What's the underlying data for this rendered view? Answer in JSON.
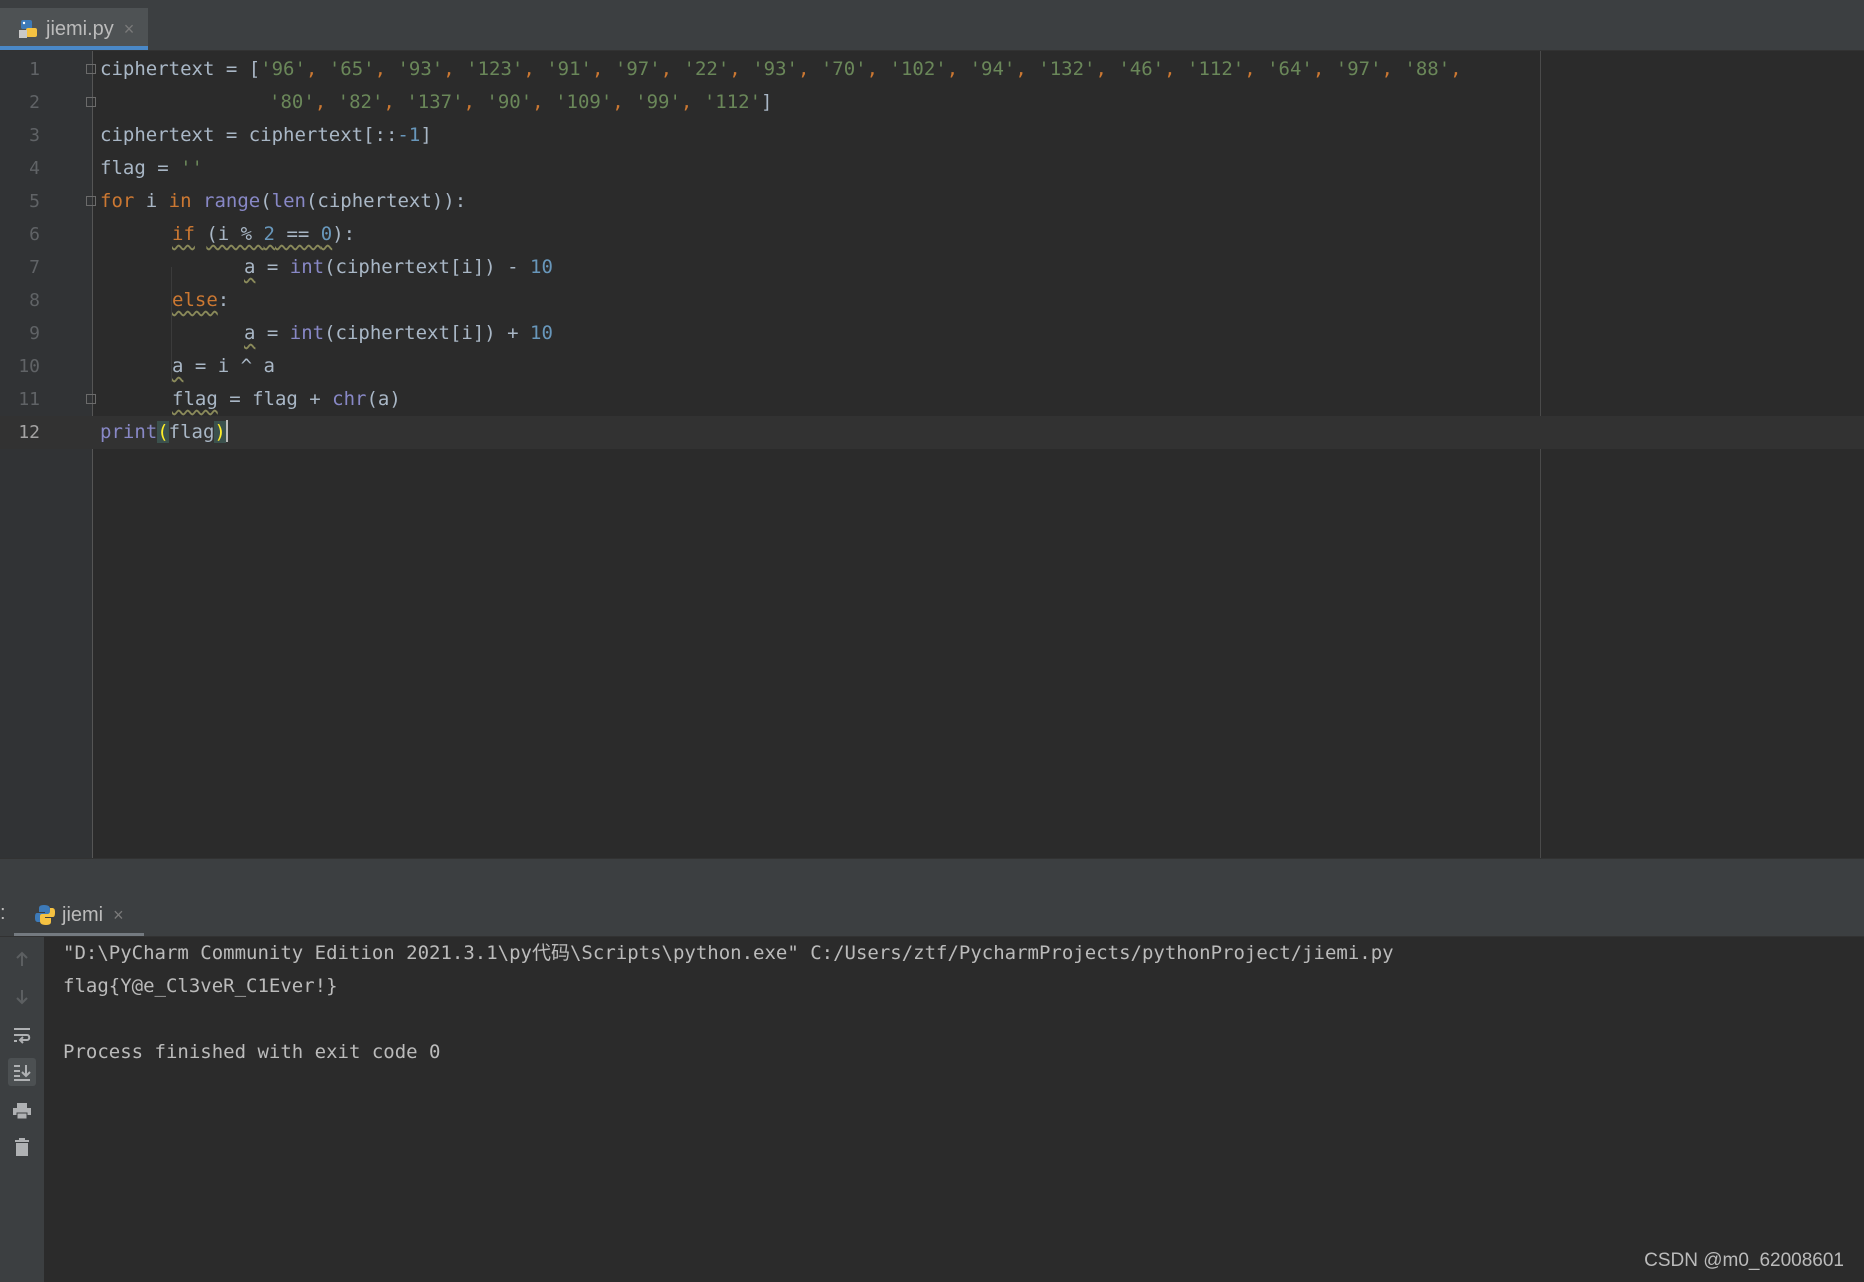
{
  "editor_tab": {
    "label": "jiemi.py",
    "close": "×"
  },
  "line_numbers": [
    "1",
    "2",
    "3",
    "4",
    "5",
    "6",
    "7",
    "8",
    "9",
    "10",
    "11",
    "12"
  ],
  "code": {
    "l1": {
      "p0": "ciphertext = [",
      "items": [
        "'96'",
        "'65'",
        "'93'",
        "'123'",
        "'91'",
        "'97'",
        "'22'",
        "'93'",
        "'70'",
        "'102'",
        "'94'",
        "'132'",
        "'46'",
        "'112'",
        "'64'",
        "'97'",
        "'88'"
      ]
    },
    "l2": {
      "items": [
        "'80'",
        "'82'",
        "'137'",
        "'90'",
        "'109'",
        "'99'",
        "'112'"
      ],
      "close": "]"
    },
    "l3": {
      "p0": "ciphertext = ciphertext[::",
      "num": "-1",
      "p1": "]"
    },
    "l4": {
      "p0": "flag = ",
      "str": "''"
    },
    "l5": {
      "kw1": "for",
      "p0": " i ",
      "kw2": "in",
      "p1": " ",
      "bi1": "range",
      "p2": "(",
      "bi2": "len",
      "p3": "(ciphertext)):"
    },
    "l6": {
      "kw": "if",
      "p0": " ",
      "c1": "(i % ",
      "n1": "2",
      "c2": " == ",
      "n2": "0",
      "p1": "):"
    },
    "l7": {
      "v": "a",
      "p0": " = ",
      "bi": "int",
      "p1": "(ciphertext[i]) - ",
      "num": "10"
    },
    "l8": {
      "kw": "else",
      "p0": ":"
    },
    "l9": {
      "v": "a",
      "p0": " = ",
      "bi": "int",
      "p1": "(ciphertext[i]) + ",
      "num": "10"
    },
    "l10": {
      "v": "a",
      "p0": " = i ^ a"
    },
    "l11": {
      "v": "flag",
      "p0": " = flag + ",
      "bi": "chr",
      "p1": "(a)"
    },
    "l12": {
      "bi": "print",
      "open": "(",
      "arg": "flag",
      "close": ")"
    }
  },
  "run_tab": {
    "label": "jiemi",
    "close": "×",
    "colon": ":"
  },
  "console": {
    "cmd": "\"D:\\PyCharm Community Edition 2021.3.1\\py代码\\Scripts\\python.exe\" C:/Users/ztf/PycharmProjects/pythonProject/jiemi.py",
    "output": "flag{Y@e_Cl3veR_C1Ever!}",
    "exit": "Process finished with exit code 0"
  },
  "watermark": "CSDN @m0_62008601",
  "icons": {
    "up": "arrow-up-icon",
    "down": "arrow-down-icon",
    "wrap": "soft-wrap-icon",
    "scroll": "scroll-to-end-icon",
    "print": "print-icon",
    "trash": "trash-icon"
  },
  "colors": {
    "keyword": "#cc7832",
    "string": "#6a8759",
    "number": "#6897bb",
    "builtin": "#8888c6",
    "text": "#a9b7c6",
    "background": "#2b2b2b"
  }
}
